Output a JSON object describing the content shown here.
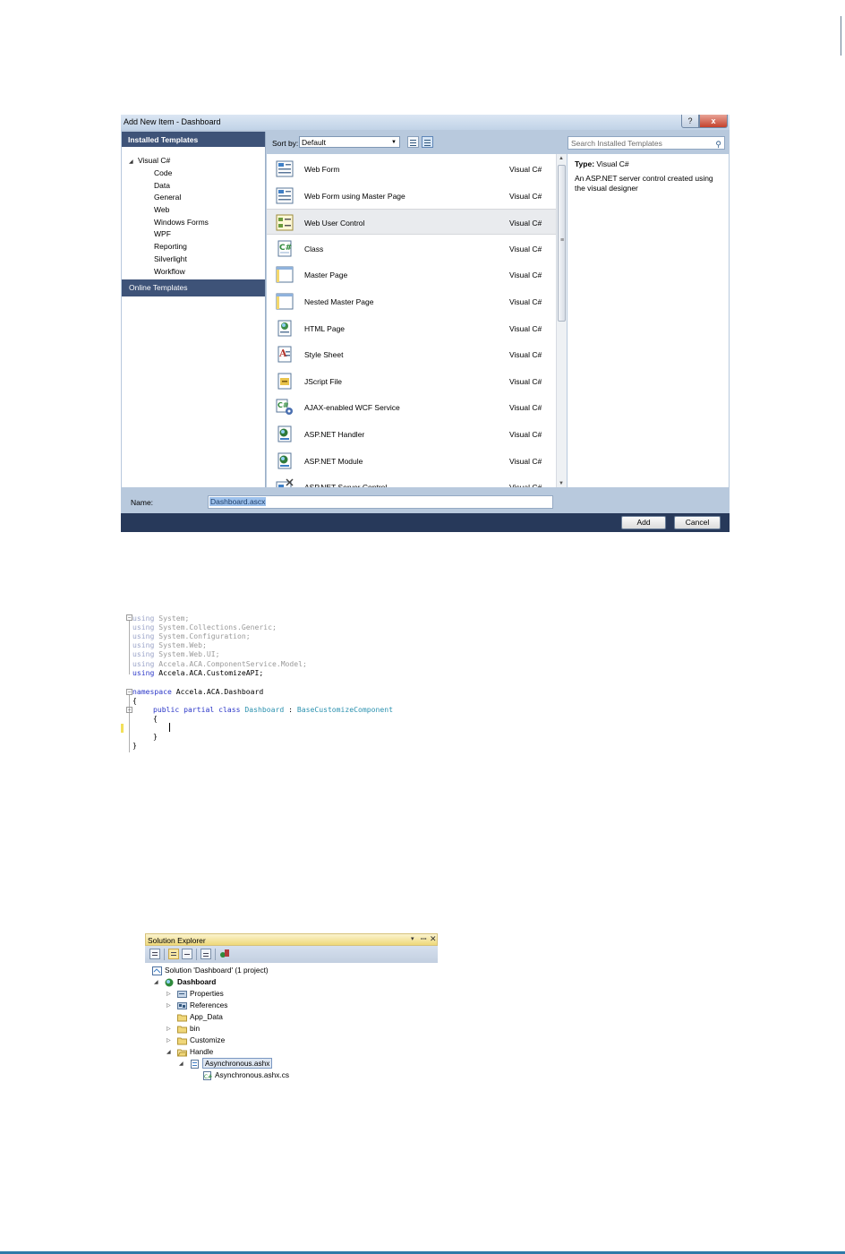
{
  "dialog": {
    "title": "Add New Item - Dashboard",
    "help_label": "?",
    "close_label": "x",
    "installed_templates": "Installed Templates",
    "tree_root": "Visual C#",
    "tree_items": [
      "Code",
      "Data",
      "General",
      "Web",
      "Windows Forms",
      "WPF",
      "Reporting",
      "Silverlight",
      "Workflow"
    ],
    "online_templates": "Online Templates",
    "sort_label": "Sort by:",
    "sort_value": "Default",
    "search_placeholder": "Search Installed Templates",
    "templates": [
      {
        "name": "Web Form",
        "lang": "Visual C#",
        "icon": "web-form-icon"
      },
      {
        "name": "Web Form using Master Page",
        "lang": "Visual C#",
        "icon": "web-form-master-icon"
      },
      {
        "name": "Web User Control",
        "lang": "Visual C#",
        "icon": "user-control-icon",
        "selected": true
      },
      {
        "name": "Class",
        "lang": "Visual C#",
        "icon": "class-icon"
      },
      {
        "name": "Master Page",
        "lang": "Visual C#",
        "icon": "master-page-icon"
      },
      {
        "name": "Nested Master Page",
        "lang": "Visual C#",
        "icon": "nested-master-page-icon"
      },
      {
        "name": "HTML Page",
        "lang": "Visual C#",
        "icon": "html-page-icon"
      },
      {
        "name": "Style Sheet",
        "lang": "Visual C#",
        "icon": "style-sheet-icon"
      },
      {
        "name": "JScript File",
        "lang": "Visual C#",
        "icon": "jscript-icon"
      },
      {
        "name": "AJAX-enabled WCF Service",
        "lang": "Visual C#",
        "icon": "wcf-service-icon"
      },
      {
        "name": "ASP.NET Handler",
        "lang": "Visual C#",
        "icon": "handler-icon"
      },
      {
        "name": "ASP.NET Module",
        "lang": "Visual C#",
        "icon": "module-icon"
      },
      {
        "name": "ASP.NET Server Control",
        "lang": "Visual C#",
        "icon": "server-control-icon"
      }
    ],
    "type_label": "Type:",
    "type_value": "Visual C#",
    "description": "An ASP.NET server control created using the visual designer",
    "name_label": "Name:",
    "name_value": "Dashboard.ascx",
    "add_label": "Add",
    "cancel_label": "Cancel"
  },
  "code": {
    "using_lines": [
      {
        "kw": "using",
        "ns": "System;"
      },
      {
        "kw": "using",
        "ns": "System.Collections.Generic;"
      },
      {
        "kw": "using",
        "ns": "System.Configuration;"
      },
      {
        "kw": "using",
        "ns": "System.Web;"
      },
      {
        "kw": "using",
        "ns": "System.Web.UI;"
      },
      {
        "kw": "using",
        "ns": "Accela.ACA.ComponentService.Model;"
      },
      {
        "kw": "using",
        "ns": "Accela.ACA.CustomizeAPI;",
        "active": true
      }
    ],
    "namespace_kw": "namespace",
    "namespace_name": "Accela.ACA.Dashboard",
    "open_brace": "{",
    "close_brace": "}",
    "class_kw": "public partial class",
    "class_name": "Dashboard",
    "colon": ":",
    "base_class": "BaseCustomizeComponent"
  },
  "solution": {
    "title": "Solution Explorer",
    "pin_label": "▾ ᵖ",
    "close_label": "✕",
    "nodes": [
      {
        "label": "Solution 'Dashboard' (1 project)",
        "icon": "solution-icon"
      },
      {
        "label": "Dashboard",
        "icon": "web-project-icon",
        "bold": true
      },
      {
        "label": "Properties",
        "icon": "properties-icon"
      },
      {
        "label": "References",
        "icon": "references-icon"
      },
      {
        "label": "App_Data",
        "icon": "folder-icon"
      },
      {
        "label": "bin",
        "icon": "folder-icon"
      },
      {
        "label": "Customize",
        "icon": "folder-icon"
      },
      {
        "label": "Handle",
        "icon": "folder-open-icon"
      },
      {
        "label": "Asynchronous.ashx",
        "icon": "ashx-file-icon",
        "selected": true
      },
      {
        "label": "Asynchronous.ashx.cs",
        "icon": "cs-file-icon"
      }
    ]
  }
}
